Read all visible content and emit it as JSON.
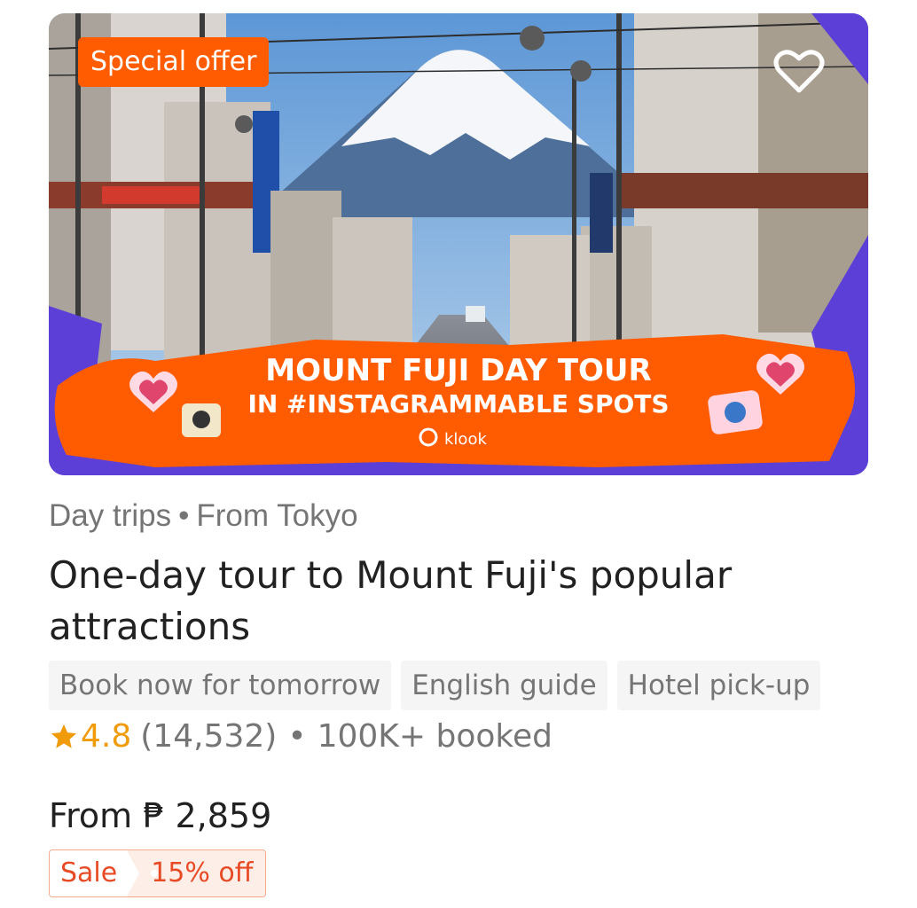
{
  "hero": {
    "badge": "Special offer",
    "banner_line1": "MOUNT FUJI DAY TOUR",
    "banner_line2": "IN #INSTAGRAMMABLE SPOTS",
    "brand": "klook",
    "favorite_icon": "heart-outline-icon",
    "colors": {
      "orange": "#ff5b00",
      "purple": "#5b3fd6",
      "sky": "#6fa3d9"
    }
  },
  "meta": {
    "category": "Day trips",
    "separator": "•",
    "origin": "From Tokyo"
  },
  "title": "One-day tour to Mount Fuji's popular attractions",
  "tags": [
    "Book now for tomorrow",
    "English guide",
    "Hotel pick-up"
  ],
  "rating": {
    "star_icon": "star-icon",
    "score": "4.8",
    "count": "(14,532)",
    "separator": "•",
    "booked": "100K+ booked"
  },
  "price": {
    "text": "From ₱ 2,859"
  },
  "sale": {
    "label": "Sale",
    "discount": "15% off"
  }
}
